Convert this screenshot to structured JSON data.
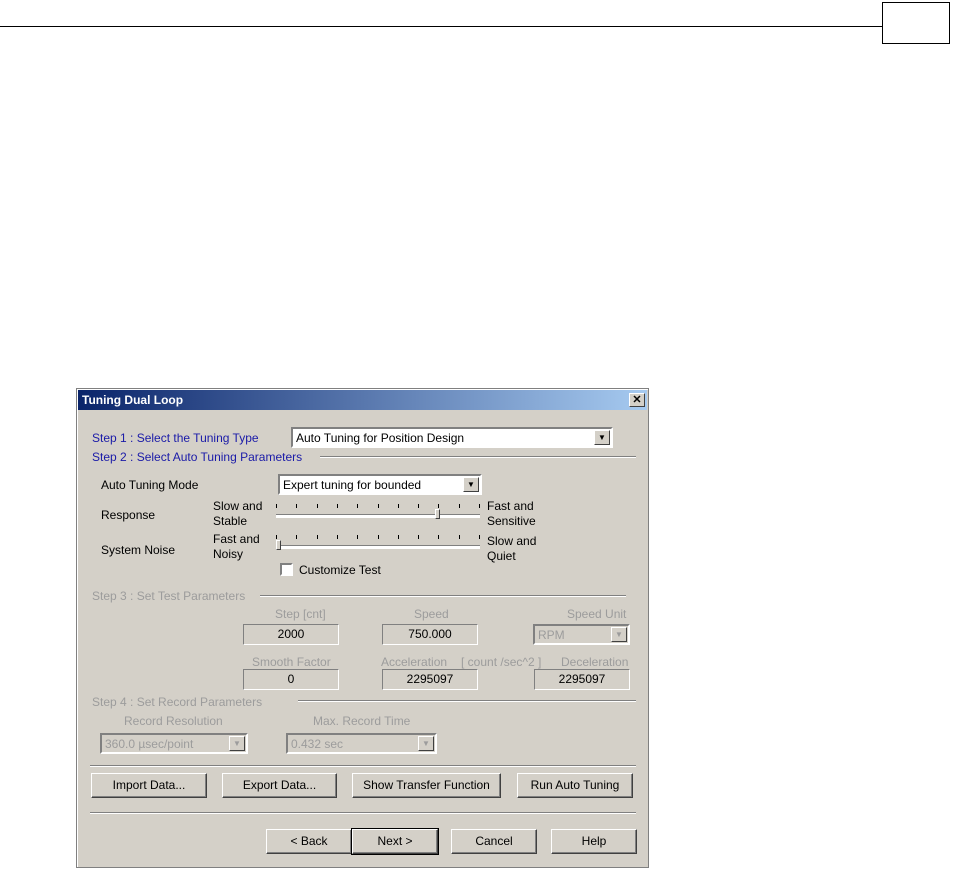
{
  "dialog": {
    "title": "Tuning Dual Loop",
    "close_glyph": "✕"
  },
  "step1": {
    "label": "Step 1 : Select the  Tuning Type",
    "tuning_type": "Auto Tuning for Position Design"
  },
  "step2": {
    "label": "Step 2 :  Select Auto Tuning Parameters",
    "mode_label": "Auto Tuning Mode",
    "mode_value": "Expert tuning for bounded",
    "response": {
      "label": "Response",
      "left_line1": "Slow and",
      "left_line2": "Stable",
      "right_line1": "Fast and",
      "right_line2": "Sensitive",
      "level": 0.8
    },
    "noise": {
      "label": "System Noise",
      "left_line1": "Fast and",
      "left_line2": "Noisy",
      "right_line1": "Slow and",
      "right_line2": "Quiet",
      "level": 0.0
    },
    "customize_label": "Customize Test",
    "customize_checked": false
  },
  "step3": {
    "label": "Step 3 : Set Test  Parameters",
    "step_label": "Step [cnt]",
    "step_value": "2000",
    "speed_label": "Speed",
    "speed_value": "750.000",
    "speed_unit_label": "Speed Unit",
    "speed_unit_value": "RPM",
    "smooth_label": "Smooth Factor",
    "smooth_value": "0",
    "accel_label": "Acceleration",
    "accel_unit": "[ count /sec^2 ]",
    "accel_value": "2295097",
    "decel_label": "Deceleration",
    "decel_value": "2295097"
  },
  "step4": {
    "label": "Step 4 : Set Record Parameters",
    "resolution_label": "Record Resolution",
    "resolution_value": "360.0 µsec/point",
    "max_time_label": "Max. Record Time",
    "max_time_value": "0.432 sec"
  },
  "actions": {
    "import": "Import Data...",
    "export": "Export Data...",
    "show_tf": "Show Transfer Function",
    "run": "Run Auto Tuning"
  },
  "nav": {
    "back": "< Back",
    "next": "Next >",
    "cancel": "Cancel",
    "help": "Help"
  },
  "colors": {
    "step_active": "#1a1aa8",
    "disabled_text": "#9c9c9c",
    "face": "#d4d0c8",
    "title_start": "#0a246a",
    "title_end": "#a6caf0"
  },
  "icons": {
    "dropdown": "chevron-down-icon",
    "close": "close-icon"
  }
}
